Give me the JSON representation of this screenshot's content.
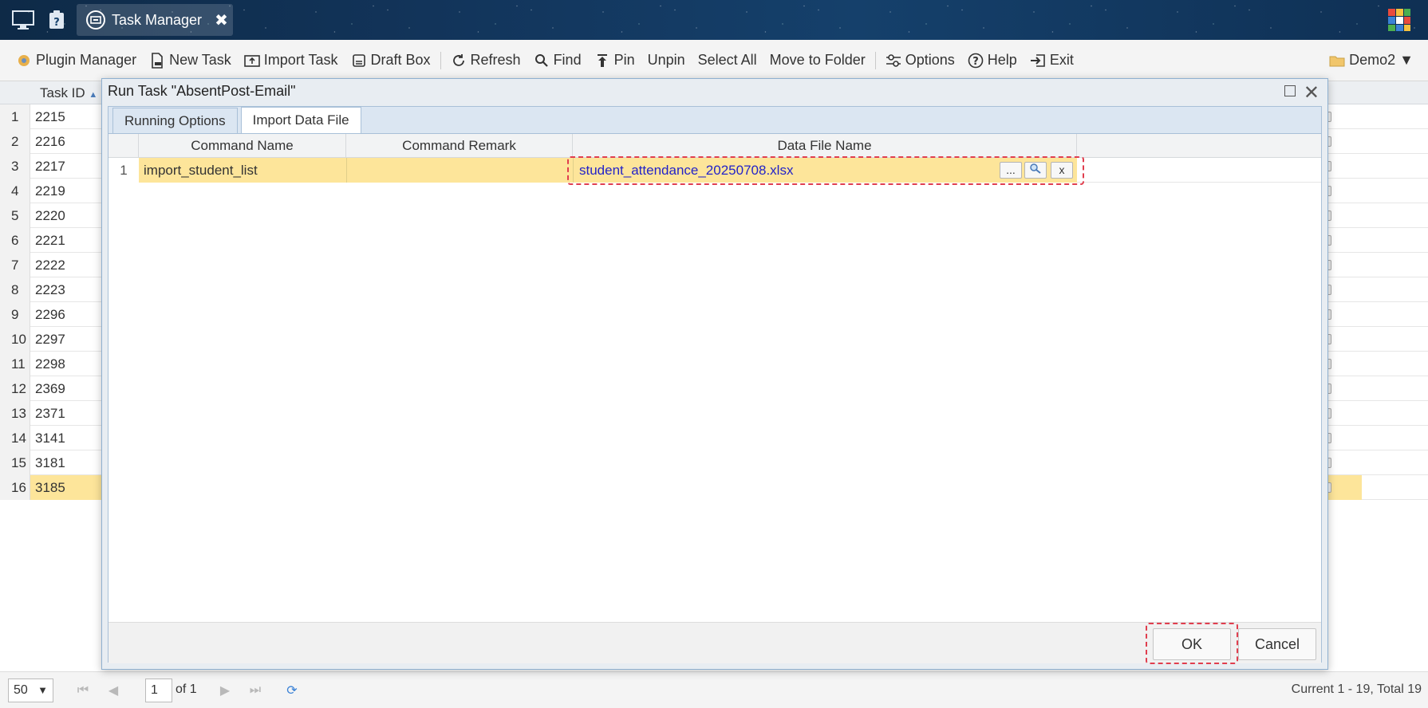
{
  "app": {
    "tab_title": "Task Manager",
    "tab_close": "✖"
  },
  "toolbar": {
    "items": [
      {
        "label": "Plugin Manager",
        "icon": "plugin-icon"
      },
      {
        "label": "New Task",
        "icon": "new-task-icon"
      },
      {
        "label": "Import Task",
        "icon": "import-icon"
      },
      {
        "label": "Draft Box",
        "icon": "draft-icon"
      },
      {
        "label": "Refresh",
        "icon": "refresh-icon"
      },
      {
        "label": "Find",
        "icon": "search-icon"
      },
      {
        "label": "Pin",
        "icon": "pin-icon"
      },
      {
        "label": "Unpin",
        "icon": ""
      },
      {
        "label": "Select All",
        "icon": ""
      },
      {
        "label": "Move to Folder",
        "icon": ""
      },
      {
        "label": "Options",
        "icon": "options-icon"
      },
      {
        "label": "Help",
        "icon": "help-icon"
      },
      {
        "label": "Exit",
        "icon": "exit-icon"
      }
    ],
    "user": "Demo2 ▼"
  },
  "grid": {
    "id_header": "Task ID",
    "rows": [
      {
        "n": "1",
        "id": "2215"
      },
      {
        "n": "2",
        "id": "2216"
      },
      {
        "n": "3",
        "id": "2217"
      },
      {
        "n": "4",
        "id": "2219"
      },
      {
        "n": "5",
        "id": "2220"
      },
      {
        "n": "6",
        "id": "2221"
      },
      {
        "n": "7",
        "id": "2222"
      },
      {
        "n": "8",
        "id": "2223"
      },
      {
        "n": "9",
        "id": "2296"
      },
      {
        "n": "10",
        "id": "2297"
      },
      {
        "n": "11",
        "id": "2298"
      },
      {
        "n": "12",
        "id": "2369"
      },
      {
        "n": "13",
        "id": "2371"
      },
      {
        "n": "14",
        "id": "3141"
      },
      {
        "n": "15",
        "id": "3181"
      },
      {
        "n": "16",
        "id": "3185"
      }
    ],
    "selected_row": "16"
  },
  "pager": {
    "page_size": "50",
    "page": "1",
    "of": "of 1",
    "summary": "Current 1 - 19, Total 19"
  },
  "dialog": {
    "title": "Run Task \"AbsentPost-Email\"",
    "close": "✕",
    "tabs": [
      "Running Options",
      "Import Data File"
    ],
    "active_tab": "Import Data File",
    "columns": [
      "Command Name",
      "Command Remark",
      "Data File Name"
    ],
    "row": {
      "n": "1",
      "command_name": "import_student_list",
      "command_remark": "",
      "data_file": "student_attendance_20250708.xlsx",
      "btn_browse": "...",
      "btn_clear": "x"
    },
    "ok": "OK",
    "cancel": "Cancel"
  },
  "colors": {
    "selection": "#fde59a",
    "highlight": "#e03e4e",
    "link": "#2323c8"
  }
}
